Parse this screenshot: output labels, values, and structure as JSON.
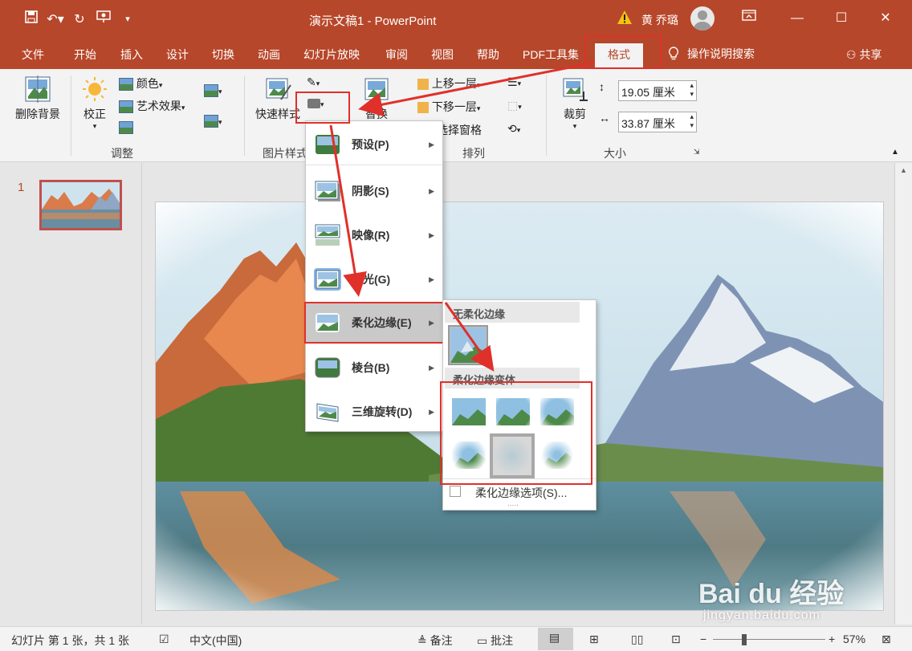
{
  "titlebar": {
    "title": "演示文稿1  -  PowerPoint",
    "user_name": "黄 乔璐",
    "qa": [
      "save-icon",
      "undo-icon",
      "redo-icon",
      "present-icon"
    ],
    "win_buttons": [
      "ribbon-display-icon",
      "minimize-icon",
      "maximize-icon",
      "close-icon"
    ]
  },
  "tabs": {
    "items": [
      "文件",
      "开始",
      "插入",
      "设计",
      "切换",
      "动画",
      "幻灯片放映",
      "审阅",
      "视图",
      "帮助",
      "PDF工具集"
    ],
    "active": "格式",
    "search": "操作说明搜索",
    "share": "共享"
  },
  "ribbon": {
    "remove_bg": "删除背景",
    "correct": "校正",
    "color": "颜色",
    "artistic": "艺术效果",
    "group_adjust": "调整",
    "quick_styles": "快速样式",
    "group_picture_styles": "图片样式",
    "replace": "替换",
    "bring_forward": "上移一层",
    "send_backward": "下移一层",
    "selection_pane": "选择窗格",
    "group_arrange": "排列",
    "crop": "裁剪",
    "height": "19.05 厘米",
    "width": "33.87 厘米",
    "group_size": "大小"
  },
  "thumbpane": {
    "slide_number": "1"
  },
  "menu": {
    "items": [
      {
        "label": "预设(P)"
      },
      {
        "label": "阴影(S)"
      },
      {
        "label": "映像(R)"
      },
      {
        "label": "发光(G)"
      },
      {
        "label": "柔化边缘(E)"
      },
      {
        "label": "棱台(B)"
      },
      {
        "label": "三维旋转(D)"
      }
    ],
    "highlighted": "柔化边缘(E)"
  },
  "submenu": {
    "header_none": "无柔化边缘",
    "header_variants": "柔化边缘变体",
    "options": "柔化边缘选项(S)...",
    "dots": "....."
  },
  "status": {
    "slide_info": "幻灯片 第 1 张，共 1 张",
    "language": "中文(中国)",
    "notes": "备注",
    "comments": "批注",
    "zoom": "57%"
  },
  "watermark": {
    "brand": "Bai du 经验",
    "url": "jingyan.baidu.com"
  },
  "colors": {
    "accent": "#b7472a",
    "highlight_box": "#e0302a"
  }
}
